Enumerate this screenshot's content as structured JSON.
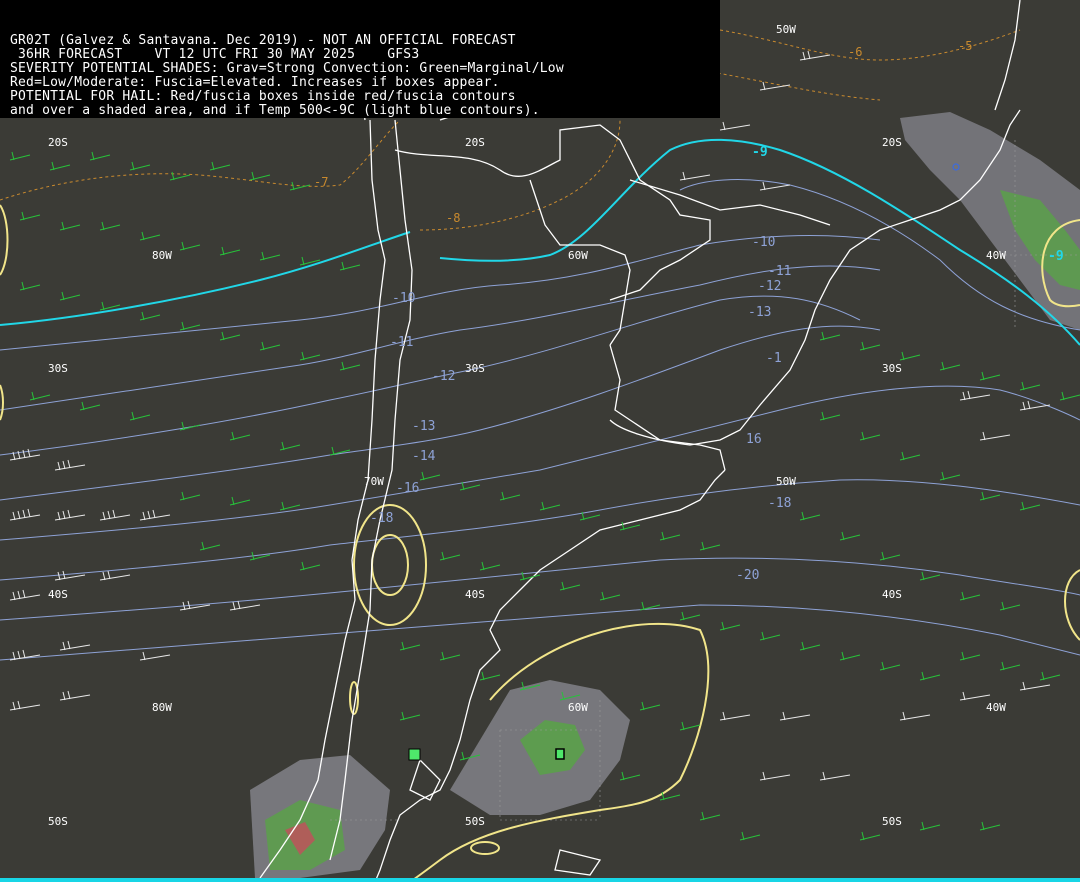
{
  "header": {
    "line1": "GR02T (Galvez & Santavana. Dec 2019) - NOT AN OFFICIAL FORECAST",
    "line2": " 36HR FORECAST    VT 12 UTC FRI 30 MAY 2025    GFS3",
    "line3": "SEVERITY POTENTIAL SHADES: Grav=Strong Convection: Green=Marginal/Low",
    "line4": "Red=Low/Moderate: Fuscia=Elevated. Increases if boxes appear.",
    "line5": "POTENTIAL FOR HAIL: Red/fuscia boxes inside red/fuscia contours",
    "line6": "and over a shaded area, and if Temp 500<-9C (light blue contours)."
  },
  "grid_labels": {
    "lat_20s_a": "20S",
    "lat_20s_b": "20S",
    "lat_20s_c": "20S",
    "lat_30s_a": "30S",
    "lat_30s_b": "30S",
    "lat_30s_c": "30S",
    "lat_40s_a": "40S",
    "lat_40s_b": "40S",
    "lat_40s_c": "40S",
    "lat_50s_a": "50S",
    "lat_50s_b": "50S",
    "lat_50s_c": "50S",
    "lon_80w_a": "80W",
    "lon_80w_b": "80W",
    "lon_70w": "70W",
    "lon_60w_a": "60W",
    "lon_60w_b": "60W",
    "lon_50w_a": "50W",
    "lon_50w_b": "50W",
    "lon_40w_a": "40W",
    "lon_40w_b": "40W"
  },
  "temp_labels": {
    "t_m5": "-5",
    "t_m6": "-6",
    "t_m7": "-7",
    "t_m8": "-8",
    "t_m9": "-9",
    "t_m9b": "-9",
    "t_m10a": "-10",
    "t_m10b": "-10",
    "t_m11a": "-11",
    "t_m11b": "-11",
    "t_m12": "-12",
    "t_m12b": "-12",
    "t_m13a": "-13",
    "t_m13b": "-13",
    "t_m14": "-14",
    "t_m16a": "-16",
    "t_m16b": "16",
    "t_m18a": "-18",
    "t_m18b": "-18",
    "t_m20": "-20",
    "t_m1": "-1"
  },
  "colors": {
    "background": "#3b3b36",
    "coast": "#ffffff",
    "temp_contour": "#8ea2d6",
    "cyan_contour": "#21d7e8",
    "orange_contour": "#c98a2e",
    "yellow_contour": "#f1e58a",
    "wind_green": "#27c23a",
    "wind_white": "#e8e8e8",
    "severity_gray": "#8a8a8e",
    "severity_green": "#5aa04a",
    "severity_red": "#b8585a"
  }
}
